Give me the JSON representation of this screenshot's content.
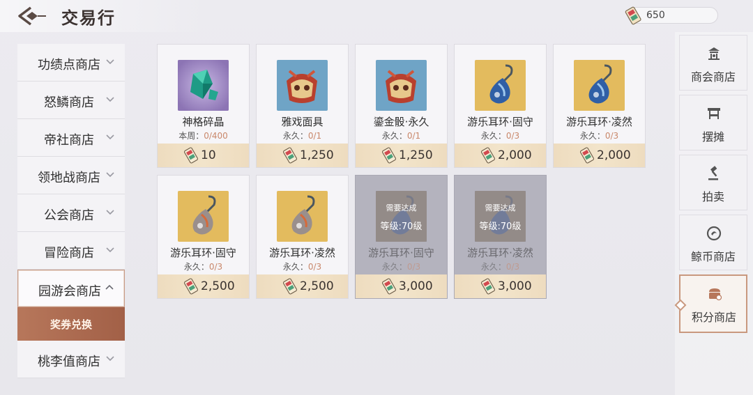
{
  "header": {
    "title": "交易行",
    "currency": "650",
    "currency_icon": "ticket-icon"
  },
  "left_nav": {
    "items": [
      {
        "label": "功绩点商店"
      },
      {
        "label": "怒鳞商店"
      },
      {
        "label": "帝社商店"
      },
      {
        "label": "领地战商店"
      },
      {
        "label": "公会商店"
      },
      {
        "label": "冒险商店"
      },
      {
        "label": "园游会商店"
      },
      {
        "label": "桃李值商店"
      }
    ],
    "active_index": 6,
    "sub_item": {
      "label": "奖券兑换"
    }
  },
  "items": [
    {
      "name": "神格碎晶",
      "limit_prefix": "本周：",
      "limit": "0/400",
      "price": "10",
      "icon": "crystal-shard-icon",
      "locked": false
    },
    {
      "name": "雅戏面具",
      "limit_prefix": "永久：",
      "limit": "0/1",
      "price": "1,250",
      "icon": "mask-icon",
      "locked": false
    },
    {
      "name": "鎏金骰·永久",
      "limit_prefix": "永久：",
      "limit": "0/1",
      "price": "1,250",
      "icon": "dice-icon",
      "locked": false
    },
    {
      "name": "游乐耳环·固守",
      "limit_prefix": "永久：",
      "limit": "0/3",
      "price": "2,000",
      "icon": "earring-icon",
      "locked": false
    },
    {
      "name": "游乐耳环·凌然",
      "limit_prefix": "永久：",
      "limit": "0/3",
      "price": "2,000",
      "icon": "earring-icon",
      "locked": false
    },
    {
      "name": "游乐耳环·固守",
      "limit_prefix": "永久：",
      "limit": "0/3",
      "price": "2,500",
      "icon": "earring-icon",
      "locked": false
    },
    {
      "name": "游乐耳环·凌然",
      "limit_prefix": "永久：",
      "limit": "0/3",
      "price": "2,500",
      "icon": "earring-icon",
      "locked": false
    },
    {
      "name": "游乐耳环·固守",
      "limit_prefix": "永久：",
      "limit": "0/3",
      "price": "3,000",
      "icon": "earring-icon",
      "locked": true,
      "lock_line1": "需要达成",
      "lock_line2": "等级:70级"
    },
    {
      "name": "游乐耳环·凌然",
      "limit_prefix": "永久：",
      "limit": "0/3",
      "price": "3,000",
      "icon": "earring-icon",
      "locked": true,
      "lock_line1": "需要达成",
      "lock_line2": "等级:70级"
    }
  ],
  "right_nav": {
    "tabs": [
      {
        "label": "商会商店",
        "icon": "guild-shop-icon"
      },
      {
        "label": "摆摊",
        "icon": "stall-icon"
      },
      {
        "label": "拍卖",
        "icon": "gavel-icon"
      },
      {
        "label": "鲸币商店",
        "icon": "coin-icon"
      },
      {
        "label": "积分商店",
        "icon": "points-shop-icon"
      }
    ],
    "active_index": 4
  },
  "colors": {
    "accent": "#b7775b",
    "price_bar": "#eedcbf",
    "limit_num": "#c9876a"
  }
}
